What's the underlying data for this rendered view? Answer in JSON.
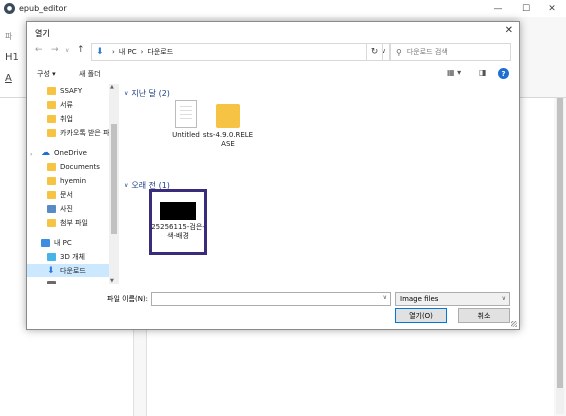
{
  "app": {
    "title": "epub_editor",
    "tool_h1": "H1",
    "tool_font": "A",
    "tool_para": "파"
  },
  "dialog": {
    "title": "열기",
    "close": "✕",
    "breadcrumb": [
      "내 PC",
      "다운로드"
    ],
    "search_placeholder": "다운로드 검색",
    "toolbar": {
      "organize": "구성 ▾",
      "new_folder": "새 폴더"
    },
    "nav_items": [
      {
        "label": "SSAFY",
        "icon": "folder-icon"
      },
      {
        "label": "서류",
        "icon": "folder-icon"
      },
      {
        "label": "취업",
        "icon": "folder-icon"
      },
      {
        "label": "카카오톡 받은 파",
        "icon": "folder-icon"
      },
      {
        "label": "OneDrive",
        "icon": "cloud-icon"
      },
      {
        "label": "Documents",
        "icon": "folder-icon"
      },
      {
        "label": "hyemin",
        "icon": "folder-icon"
      },
      {
        "label": "문서",
        "icon": "folder-icon"
      },
      {
        "label": "사진",
        "icon": "pictures-icon"
      },
      {
        "label": "첨부 파일",
        "icon": "folder-icon"
      },
      {
        "label": "내 PC",
        "icon": "pc-icon"
      },
      {
        "label": "3D 개체",
        "icon": "3d-icon"
      },
      {
        "label": "다운로드",
        "icon": "download-icon"
      }
    ],
    "groups": [
      {
        "header": "지난 달 (2)",
        "files": [
          {
            "name": "Untitled",
            "type": "document"
          },
          {
            "name": "sts-4.9.0.RELEASE",
            "type": "folder"
          }
        ]
      },
      {
        "header": "오래 전 (1)",
        "files": [
          {
            "name": "25256115-검은-색-배경",
            "type": "image"
          }
        ]
      }
    ],
    "filename_label": "파일 이름(N):",
    "filename_value": "",
    "filetype": "Image files",
    "open_button": "열기(O)",
    "cancel_button": "취소"
  }
}
